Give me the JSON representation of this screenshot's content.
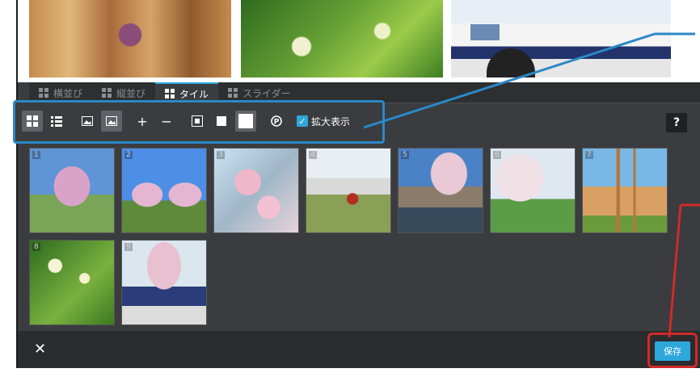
{
  "tabs": [
    {
      "label": "横並び"
    },
    {
      "label": "縦並び"
    },
    {
      "label": "タイル"
    },
    {
      "label": "スライダー"
    }
  ],
  "toolbar": {
    "enlarge_label": "拡大表示",
    "plus": "+",
    "minus": "−",
    "pinterest": "P"
  },
  "help_label": "?",
  "thumbnails": [
    {
      "num": "1"
    },
    {
      "num": "2"
    },
    {
      "num": "3"
    },
    {
      "num": "4"
    },
    {
      "num": "5"
    },
    {
      "num": "6"
    },
    {
      "num": "7"
    },
    {
      "num": "8"
    },
    {
      "num": "9"
    }
  ],
  "bottom": {
    "close_label": "✕",
    "save_label": "保存"
  },
  "colors": {
    "accent": "#2ea7dd",
    "callout_blue": "#2b88c6",
    "callout_red": "#d12a2a"
  }
}
